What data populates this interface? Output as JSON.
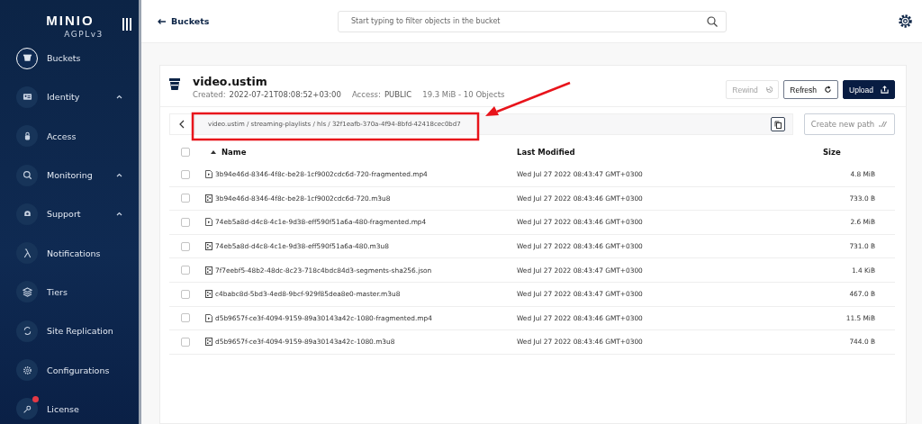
{
  "sidebar": {
    "logo": "MINIO",
    "license_label": "AGPLv3",
    "items": [
      {
        "label": "Buckets",
        "selected": true,
        "expandable": false,
        "badge": false
      },
      {
        "label": "Identity",
        "selected": false,
        "expandable": true,
        "badge": false
      },
      {
        "label": "Access",
        "selected": false,
        "expandable": false,
        "badge": false
      },
      {
        "label": "Monitoring",
        "selected": false,
        "expandable": true,
        "badge": false
      },
      {
        "label": "Support",
        "selected": false,
        "expandable": true,
        "badge": false
      },
      {
        "label": "Notifications",
        "selected": false,
        "expandable": false,
        "badge": false
      },
      {
        "label": "Tiers",
        "selected": false,
        "expandable": false,
        "badge": false
      },
      {
        "label": "Site Replication",
        "selected": false,
        "expandable": false,
        "badge": false
      },
      {
        "label": "Configurations",
        "selected": false,
        "expandable": false,
        "badge": false
      },
      {
        "label": "License",
        "selected": false,
        "expandable": false,
        "badge": true
      }
    ]
  },
  "topbar": {
    "back_label": "Buckets",
    "search": {
      "placeholder": "Start typing to filter objects in the bucket"
    }
  },
  "bucket": {
    "name": "video.ustim",
    "created_label": "Created:",
    "created": "2022-07-21T08:08:52+03:00",
    "access_label": "Access:",
    "access": "PUBLIC",
    "usage": "19.3 MiB - 10 Objects"
  },
  "actions": [
    {
      "label": "Rewind",
      "kind": "rewind",
      "disabled": true
    },
    {
      "label": "Refresh",
      "kind": "refresh",
      "disabled": false
    },
    {
      "label": "Upload",
      "kind": "upload",
      "disabled": false
    }
  ],
  "breadcrumb": "video.ustim / streaming-playlists / hls / 32f1eafb-370a-4f94-8bfd-42418cec0bd7",
  "create_path_label": "Create new path",
  "table": {
    "columns": [
      "Name",
      "Last Modified",
      "Size"
    ],
    "all_checked": false,
    "rows": [
      {
        "name": "3b94e46d-8346-4f8c-be28-1cf9002cdc6d-720-fragmented.mp4",
        "kind": "video",
        "modified": "Wed Jul 27 2022 08:43:47 GMT+0300",
        "size": "4.8 MiB",
        "checked": false
      },
      {
        "name": "3b94e46d-8346-4f8c-be28-1cf9002cdc6d-720.m3u8",
        "kind": "file",
        "modified": "Wed Jul 27 2022 08:43:46 GMT+0300",
        "size": "733.0 B",
        "checked": false
      },
      {
        "name": "74eb5a8d-d4c8-4c1e-9d38-eff590f51a6a-480-fragmented.mp4",
        "kind": "video",
        "modified": "Wed Jul 27 2022 08:43:46 GMT+0300",
        "size": "2.6 MiB",
        "checked": false
      },
      {
        "name": "74eb5a8d-d4c8-4c1e-9d38-eff590f51a6a-480.m3u8",
        "kind": "file",
        "modified": "Wed Jul 27 2022 08:43:46 GMT+0300",
        "size": "731.0 B",
        "checked": false
      },
      {
        "name": "7f7eebf5-48b2-48dc-8c23-718c4bdc84d3-segments-sha256.json",
        "kind": "file",
        "modified": "Wed Jul 27 2022 08:43:47 GMT+0300",
        "size": "1.4 KiB",
        "checked": false
      },
      {
        "name": "c4babc8d-5bd3-4ed8-9bcf-929f85dea8e0-master.m3u8",
        "kind": "file",
        "modified": "Wed Jul 27 2022 08:43:47 GMT+0300",
        "size": "467.0 B",
        "checked": false
      },
      {
        "name": "d5b9657f-ce3f-4094-9159-89a30143a42c-1080-fragmented.mp4",
        "kind": "video",
        "modified": "Wed Jul 27 2022 08:43:46 GMT+0300",
        "size": "11.5 MiB",
        "checked": false
      },
      {
        "name": "d5b9657f-ce3f-4094-9159-89a30143a42c-1080.m3u8",
        "kind": "file",
        "modified": "Wed Jul 27 2022 08:43:46 GMT+0300",
        "size": "744.0 B",
        "checked": false
      }
    ]
  }
}
